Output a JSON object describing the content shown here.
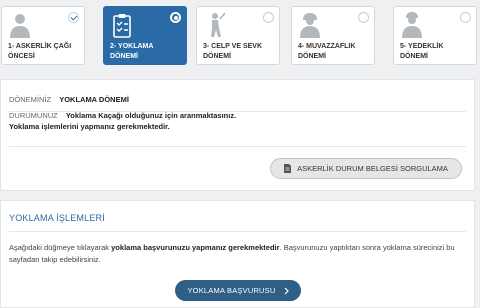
{
  "steps": [
    {
      "label": "1- ASKERLİK ÇAĞI\nÖNCESİ",
      "icon": "person-icon",
      "state": "completed"
    },
    {
      "label": "2- YOKLAMA\nDÖNEMİ",
      "icon": "clipboard-check-icon",
      "state": "active"
    },
    {
      "label": "3- CELP VE SEVK\nDÖNEMİ",
      "icon": "soldier-walking-icon",
      "state": "pending"
    },
    {
      "label": "4- MUVAZZAFLIK\nDÖNEMİ",
      "icon": "soldier-helmet-icon",
      "state": "pending"
    },
    {
      "label": "5- YEDEKLİK\nDÖNEMİ",
      "icon": "reserve-soldier-icon",
      "state": "pending"
    }
  ],
  "info": {
    "period_label": "DÖNEMİNİZ",
    "period_value": "YOKLAMA DÖNEMİ",
    "status_label": "DURUMUNUZ",
    "status_line1": "Yoklama Kaçağı olduğunuz için aranmaktasınız.",
    "status_line2": "Yoklama işlemlerini yapmanız gerekmektedir.",
    "query_button": "ASKERLİK DURUM BELGESİ SORGULAMA"
  },
  "ops": {
    "title": "YOKLAMA İŞLEMLERİ",
    "desc_part1": "Aşağıdaki düğmeye tıklayarak ",
    "desc_bold": "yoklama başvurunuzu yapmanız gerekmektedir",
    "desc_part2": ". Başvurunuzu yaptıktan sonra yoklama sürecinizi bu sayfadan takip edebilirsiniz.",
    "apply_button": "YOKLAMA BAŞVURUSU"
  },
  "colors": {
    "accent": "#2a6ba7",
    "button_dark": "#2f5f86",
    "icon_gray": "#b3b8bd"
  }
}
